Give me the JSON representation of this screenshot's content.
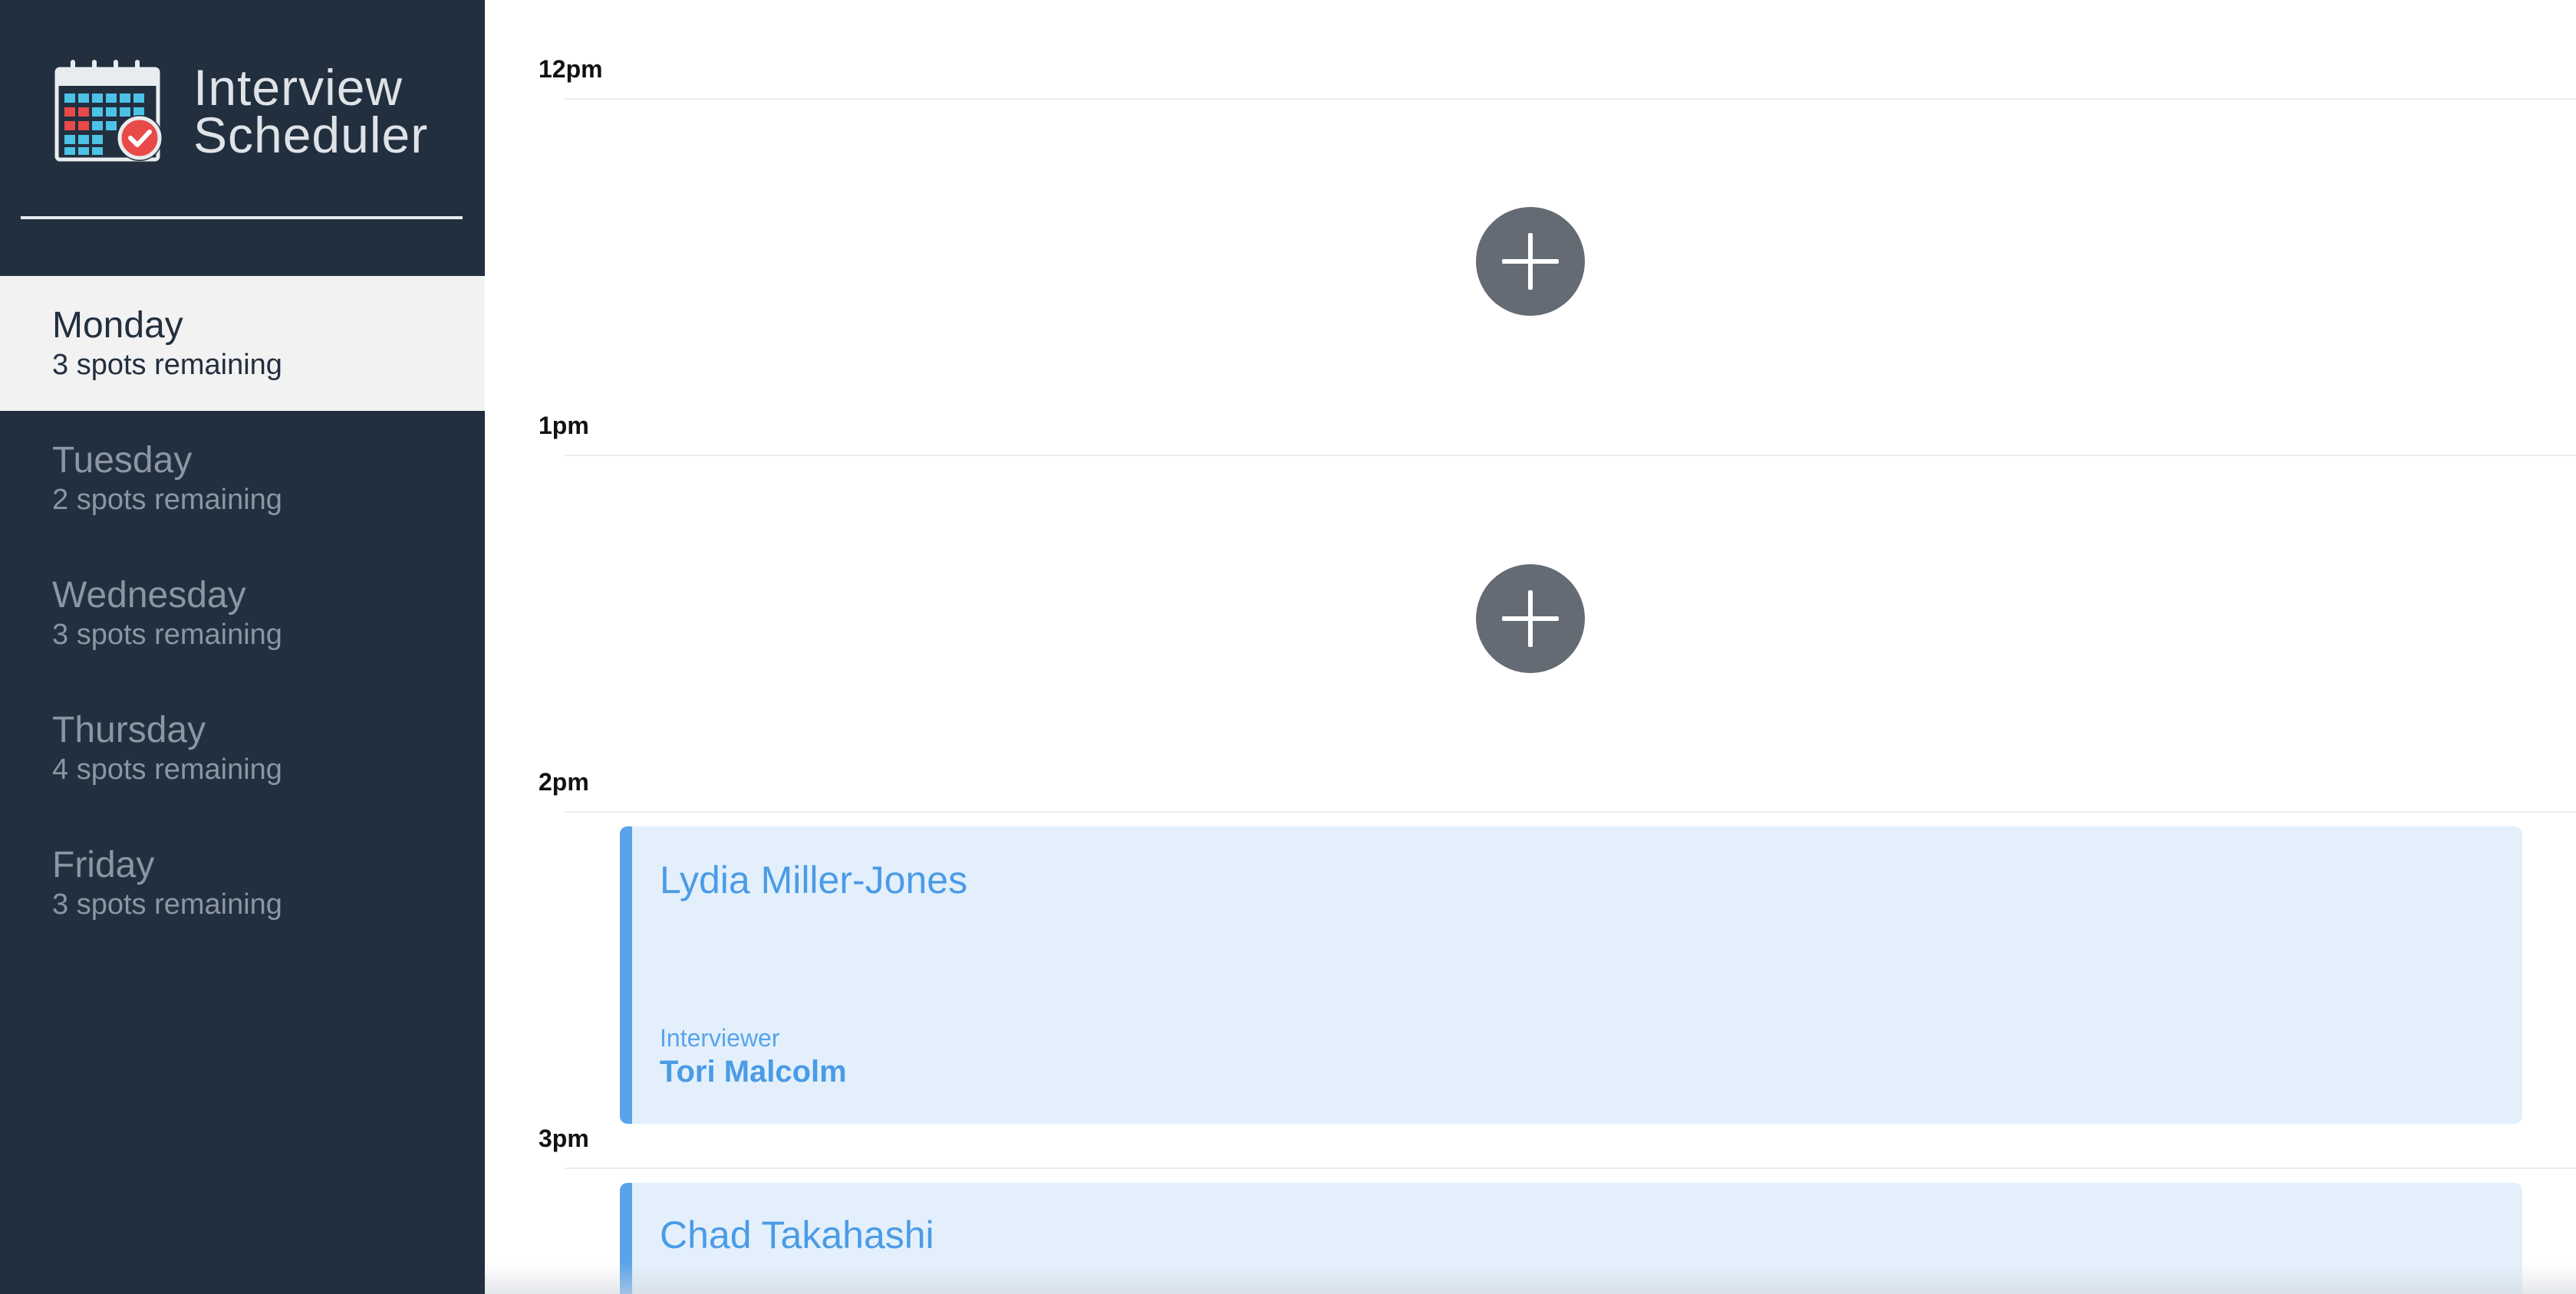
{
  "app": {
    "title_line1": "Interview",
    "title_line2": "Scheduler",
    "logo_icon": "calendar-check-icon"
  },
  "sidebar": {
    "days": [
      {
        "name": "Monday",
        "spots": "3 spots remaining",
        "selected": true
      },
      {
        "name": "Tuesday",
        "spots": "2 spots remaining",
        "selected": false
      },
      {
        "name": "Wednesday",
        "spots": "3 spots remaining",
        "selected": false
      },
      {
        "name": "Thursday",
        "spots": "4 spots remaining",
        "selected": false
      },
      {
        "name": "Friday",
        "spots": "3 spots remaining",
        "selected": false
      }
    ]
  },
  "schedule": {
    "slots": [
      {
        "time": "12pm",
        "type": "empty",
        "add_icon": "plus-icon"
      },
      {
        "time": "1pm",
        "type": "empty",
        "add_icon": "plus-icon"
      },
      {
        "time": "2pm",
        "type": "booked",
        "student": "Lydia Miller-Jones",
        "interviewer_label": "Interviewer",
        "interviewer": "Tori Malcolm"
      },
      {
        "time": "3pm",
        "type": "booked",
        "student": "Chad Takahashi"
      }
    ]
  },
  "colors": {
    "sidebar_bg": "#222f3e",
    "selected_day_bg": "#f2f2f2",
    "add_button": "#646b74",
    "appointment_bg": "#e3f0fc",
    "appointment_accent": "#5aa3ea"
  }
}
